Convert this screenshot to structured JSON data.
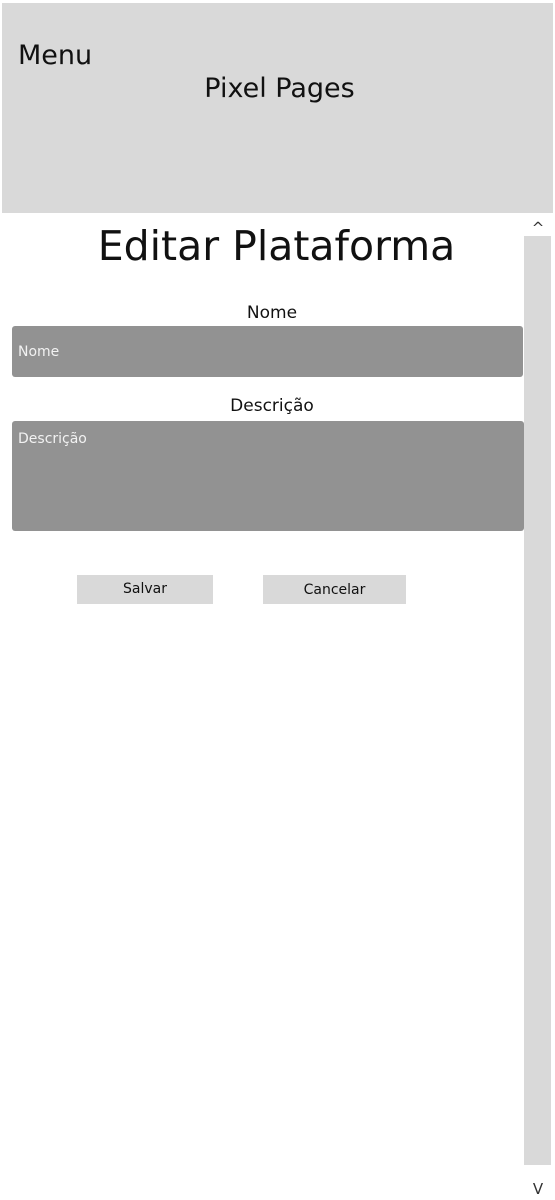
{
  "header": {
    "menu_label": "Menu",
    "brand": "Pixel Pages"
  },
  "main": {
    "title": "Editar Plataforma",
    "nome": {
      "label": "Nome",
      "placeholder": "Nome",
      "value": ""
    },
    "descricao": {
      "label": "Descrição",
      "placeholder": "Descrição",
      "value": ""
    },
    "buttons": {
      "save": "Salvar",
      "cancel": "Cancelar"
    }
  },
  "scrollbar": {
    "up_icon": "^",
    "down_icon": "V"
  },
  "colors": {
    "header_bg": "#d9d9d9",
    "input_bg": "#929292",
    "button_bg": "#d9d9d9",
    "scrollbar_bg": "#d9d9d9"
  }
}
